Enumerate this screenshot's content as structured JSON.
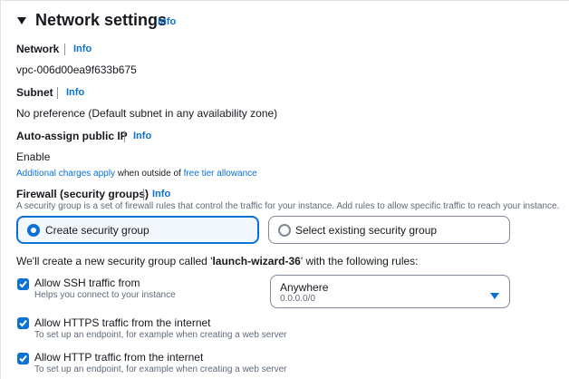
{
  "section": {
    "title": "Network settings",
    "info": "Info"
  },
  "network": {
    "label": "Network",
    "info": "Info",
    "value": "vpc-006d00ea9f633b675"
  },
  "subnet": {
    "label": "Subnet",
    "info": "Info",
    "value": "No preference (Default subnet in any availability zone)"
  },
  "public_ip": {
    "label": "Auto-assign public IP",
    "info": "Info",
    "value": "Enable",
    "note_link1": "Additional charges apply",
    "note_mid": " when outside of ",
    "note_link2": "free tier allowance"
  },
  "firewall": {
    "label": "Firewall (security groups)",
    "info": "Info",
    "description": "A security group is a set of firewall rules that control the traffic for your instance. Add rules to allow specific traffic to reach your instance.",
    "option_create": "Create security group",
    "option_existing": "Select existing security group",
    "selected": "create"
  },
  "rules_intro": {
    "prefix": "We'll create a new security group called '",
    "group_name": "launch-wizard-36",
    "suffix": "' with the following rules:"
  },
  "rules": [
    {
      "label": "Allow SSH traffic from",
      "hint": "Helps you connect to your instance",
      "checked": true
    },
    {
      "label": "Allow HTTPS traffic from the internet",
      "hint": "To set up an endpoint, for example when creating a web server",
      "checked": true
    },
    {
      "label": "Allow HTTP traffic from the internet",
      "hint": "To set up an endpoint, for example when creating a web server",
      "checked": true
    }
  ],
  "ssh_source": {
    "value": "Anywhere",
    "sub": "0.0.0.0/0"
  },
  "colors": {
    "accent": "#0972d3",
    "selected_bg": "#f2f8fd",
    "text": "#16191f",
    "muted": "#5f6b7a"
  }
}
